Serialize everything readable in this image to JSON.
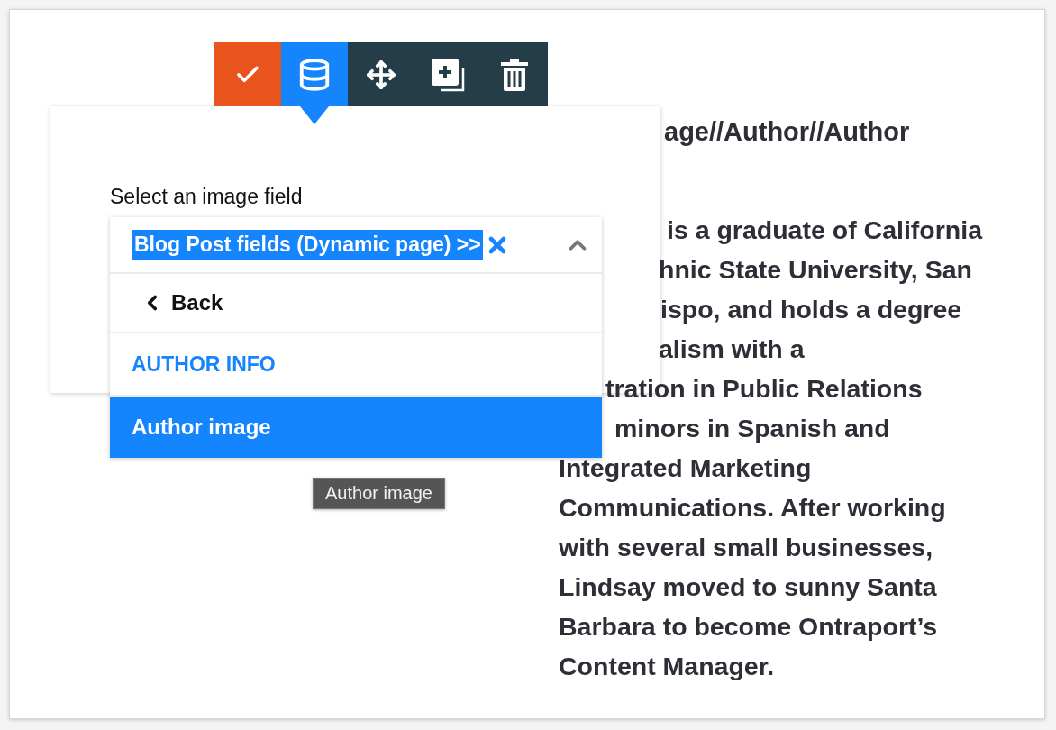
{
  "toolbar": {
    "buttons": [
      {
        "kind": "confirm",
        "selected": false
      },
      {
        "kind": "data",
        "selected": true
      },
      {
        "kind": "move",
        "selected": false
      },
      {
        "kind": "duplicate",
        "selected": false
      },
      {
        "kind": "delete",
        "selected": false
      }
    ]
  },
  "popover": {
    "label": "Select an image field",
    "select": {
      "value": "Blog Post fields (Dynamic page) >>",
      "expanded": true,
      "options": [
        {
          "kind": "back",
          "label": "Back",
          "selected": false
        },
        {
          "kind": "group",
          "label": "AUTHOR INFO",
          "selected": false
        },
        {
          "kind": "option",
          "label": "Author image",
          "selected": true
        }
      ]
    }
  },
  "tooltip": "Author image",
  "content": {
    "heading": "age//Author//Author",
    "lines": [
      "is a graduate of California",
      "hnic State University, San",
      "ispo, and holds a degree",
      "alism with a",
      "tration in Public Relations",
      "minors in Spanish and",
      "Integrated Marketing",
      "Communications. After working",
      "with several small businesses,",
      "Lindsay moved to sunny Santa",
      "Barbara to become Ontraport’s",
      "Content Manager."
    ]
  }
}
